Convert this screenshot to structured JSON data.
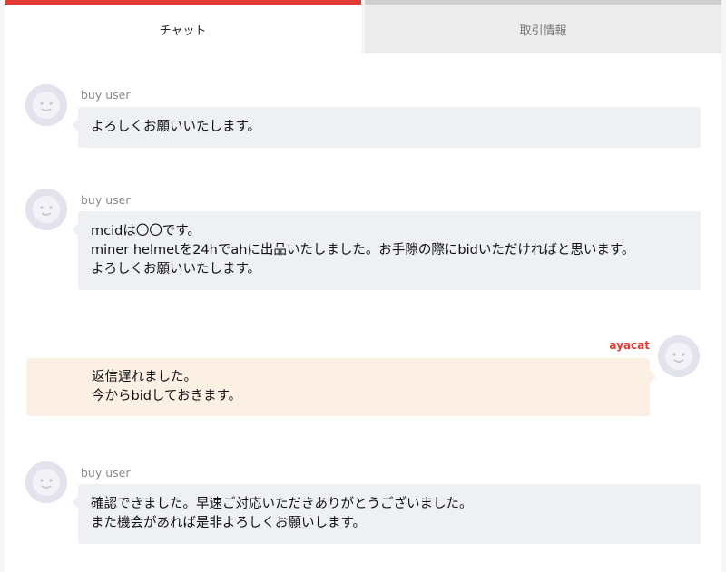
{
  "tabs": {
    "chat": "チャット",
    "info": "取引情報"
  },
  "messages": [
    {
      "user": "buy user",
      "lines": [
        "よろしくお願いいたします。"
      ]
    },
    {
      "user": "buy user",
      "lines": [
        "mcidは〇〇です。",
        "miner helmetを24hでahに出品いたしました。お手隙の際にbidいただければと思います。",
        "よろしくお願いいたします。"
      ]
    },
    {
      "user": "ayacat",
      "lines": [
        "返信遅れました。",
        "今からbidしておきます。"
      ]
    },
    {
      "user": "buy user",
      "lines": [
        "確認できました。早速ご対応いただきありがとうございました。",
        "また機会があれば是非よろしくお願いします。"
      ]
    }
  ],
  "colors": {
    "accent": "#e23b36",
    "bubble_other": "#eff0f4",
    "bubble_self": "#fcefe4"
  },
  "icons": {
    "avatar": "user-face-icon"
  }
}
